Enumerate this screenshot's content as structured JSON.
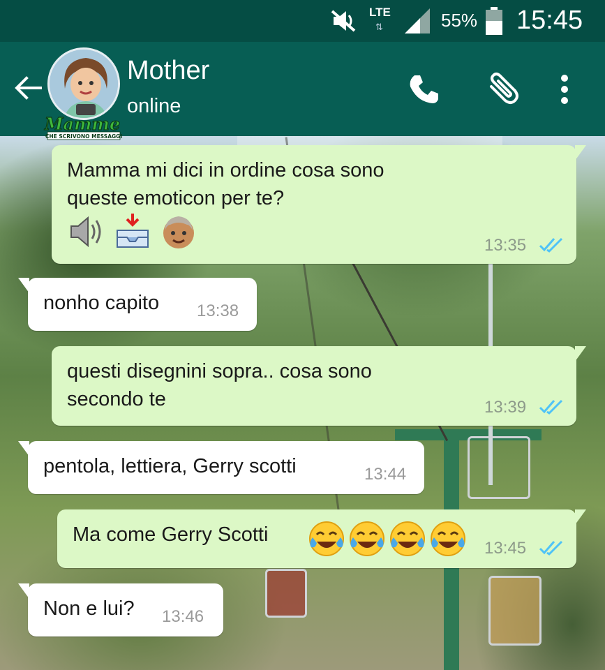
{
  "status_bar": {
    "network": "LTE",
    "battery_percent": "55%",
    "time": "15:45"
  },
  "header": {
    "contact_name": "Mother",
    "contact_status": "online",
    "logo_text": "Mamme",
    "logo_subtitle": "CHE SCRIVONO MESSAGGI"
  },
  "messages": [
    {
      "direction": "out",
      "text": "Mamma mi dici in ordine cosa sono\nqueste emoticon per te?",
      "emojis": [
        "speaker-emoji",
        "inbox-tray-emoji",
        "older-man-emoji"
      ],
      "time": "13:35",
      "read": true
    },
    {
      "direction": "in",
      "text": "nonho capito",
      "time": "13:38"
    },
    {
      "direction": "out",
      "text": "questi disegnini sopra.. cosa sono\nsecondo te",
      "time": "13:39",
      "read": true
    },
    {
      "direction": "in",
      "text": "pentola, lettiera, Gerry scotti",
      "time": "13:44"
    },
    {
      "direction": "out",
      "text": "Ma come Gerry Scotti",
      "emojis": [
        "tears-of-joy-emoji",
        "tears-of-joy-emoji",
        "tears-of-joy-emoji",
        "tears-of-joy-emoji"
      ],
      "time": "13:45",
      "read": true
    },
    {
      "direction": "in",
      "text": "Non e lui?",
      "time": "13:46"
    }
  ],
  "colors": {
    "status_bar": "#054d44",
    "header": "#075e54",
    "outgoing_bubble": "#dcf8c6",
    "incoming_bubble": "#ffffff",
    "read_ticks": "#4fc3f7"
  }
}
